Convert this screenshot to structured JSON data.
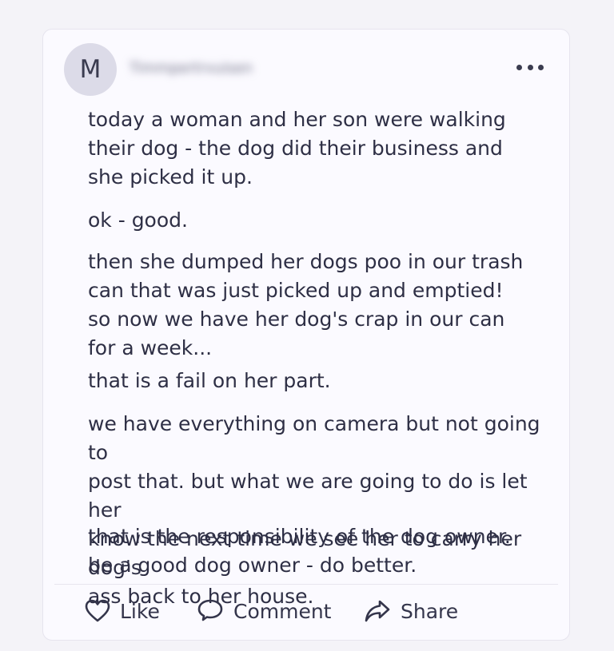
{
  "author": {
    "initial": "M",
    "name": "Timmpertrvuisen"
  },
  "post": {
    "paragraphs": [
      "today a woman and her son were walking\ntheir dog - the dog did their business and\nshe picked it up.",
      "ok - good.",
      "then she dumped her dogs poo in our trash\ncan that was just picked up and emptied!\nso now we have her dog's crap in our can\nfor a week...",
      "that is a fail on her part.",
      "we have everything on camera but not going to\npost that. but what we are going to do is let her\nknow the next time we see her to carry her dog's\nass back to her house.",
      "that is the responsibility of the dog owner.\nbe a good dog owner - do better."
    ]
  },
  "actions": {
    "like_label": "Like",
    "comment_label": "Comment",
    "share_label": "Share"
  },
  "icons": {
    "more": "more-horizontal-icon",
    "like": "heart-icon",
    "comment": "speech-bubble-icon",
    "share": "share-arrow-icon"
  },
  "colors": {
    "background": "#f4f3f8",
    "card": "#fbfaff",
    "text": "#2e2f45",
    "avatar_bg": "#dcdbe8"
  }
}
